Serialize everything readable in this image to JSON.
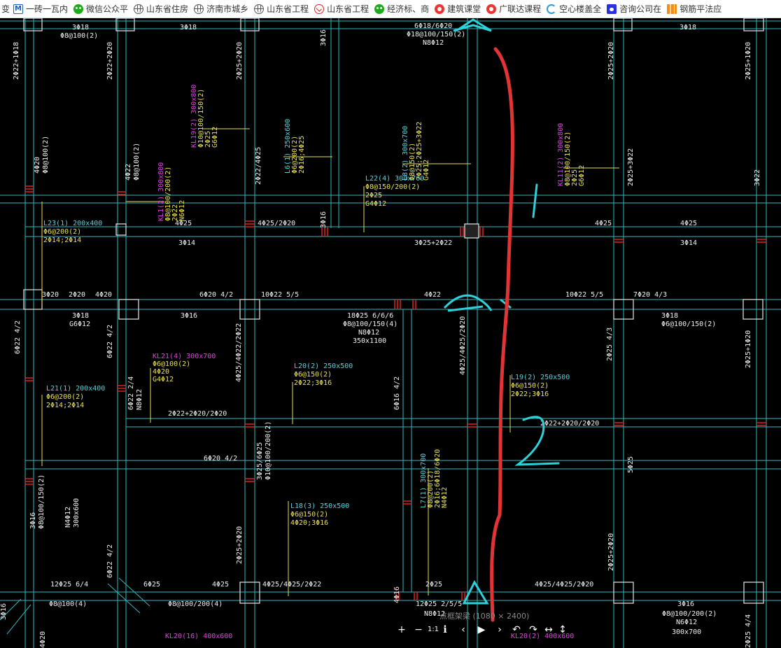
{
  "bookmarks": {
    "edge_glyph": "变",
    "items": [
      {
        "label": "一砖一瓦内",
        "icon": "m-logo-icon"
      },
      {
        "label": "微信公众平",
        "icon": "wechat-icon"
      },
      {
        "label": "山东省住房",
        "icon": "globe-icon"
      },
      {
        "label": "济南市城乡",
        "icon": "globe-icon"
      },
      {
        "label": "山东省工程",
        "icon": "globe-icon"
      },
      {
        "label": "山东省工程",
        "icon": "shield-icon"
      },
      {
        "label": "经济标、商",
        "icon": "wechat-icon"
      },
      {
        "label": "建筑课堂",
        "icon": "red-circle-icon"
      },
      {
        "label": "广联达课程",
        "icon": "red-circle-icon"
      },
      {
        "label": "空心楼盖全",
        "icon": "c-logo-icon"
      },
      {
        "label": "咨询公司在",
        "icon": "paw-icon"
      },
      {
        "label": "钢筋平法应",
        "icon": "bars-icon"
      }
    ]
  },
  "drawing": {
    "beam_labels": [
      {
        "lines": [
          "KL19(2) 300x800",
          "Φ10@100/150(2)",
          "2Φ25",
          "G6Φ12"
        ],
        "color": "magenta"
      },
      {
        "lines": [
          "KL1(2) 300x800",
          "Φ8@100/200(2)",
          "2Φ22",
          "N6Φ12"
        ],
        "color": "magenta"
      },
      {
        "lines": [
          "KL11(2) 300x800",
          "Φ8@100/150(2)",
          "2Φ25",
          "G6Φ12"
        ],
        "color": "magenta"
      },
      {
        "lines": [
          "KL21(4) 300x700",
          "Φ6@100(2)",
          "4Φ20",
          "G4Φ12"
        ],
        "color": "magenta"
      },
      {
        "lines": [
          "L6(1) 250x600",
          "Φ6@200(2)",
          "2Φ16;4Φ25"
        ],
        "color": "cyan"
      },
      {
        "lines": [
          "L8(2) 300x700",
          "Φ8@150(2)",
          "2Φ25;2Φ25+3Φ22",
          "G4Φ12"
        ],
        "color": "cyan"
      },
      {
        "lines": [
          "L22(4) 300x700",
          "Φ8@150/200(2)",
          "2Φ25",
          "G4Φ12"
        ],
        "color": "cyan"
      },
      {
        "lines": [
          "L23(1) 200x400",
          "Φ6@200(2)",
          "2Φ14;2Φ14"
        ],
        "color": "cyan"
      },
      {
        "lines": [
          "L21(1) 200x400",
          "Φ6@200(2)",
          "2Φ14;2Φ14"
        ],
        "color": "cyan"
      },
      {
        "lines": [
          "L20(2) 250x500",
          "Φ6@150(2)",
          "2Φ22;3Φ16"
        ],
        "color": "cyan"
      },
      {
        "lines": [
          "L19(2) 250x500",
          "Φ6@150(2)",
          "2Φ22;3Φ16"
        ],
        "color": "cyan"
      },
      {
        "lines": [
          "L18(3) 250x500",
          "Φ6@150(2)",
          "4Φ20;3Φ16"
        ],
        "color": "cyan"
      },
      {
        "lines": [
          "L7(1) 300x700",
          "Φ8@200(2)",
          "2Φ16;6Φ18/6Φ20",
          "N4Φ12"
        ],
        "color": "cyan"
      }
    ],
    "top_row_texts": [
      {
        "text": "3Φ18"
      },
      {
        "text": "Φ8@100(2)"
      },
      {
        "text": "3Φ18"
      },
      {
        "text": "6Φ18/6Φ20"
      },
      {
        "text": "Φ18@100/150(2)"
      },
      {
        "text": "N8Φ12"
      },
      {
        "text": "3Φ18"
      }
    ],
    "rebar_texts": [
      "4Φ25",
      "4Φ25/2Φ20",
      "3Φ14",
      "3Φ25+2Φ22",
      "4Φ25",
      "4Φ25",
      "3Φ14",
      "3Φ20",
      "2Φ20",
      "4Φ20",
      "6Φ20 4/2",
      "10Φ22 5/5",
      "4Φ22",
      "10Φ22 5/5",
      "7Φ20 4/3",
      "3Φ18",
      "G6Φ12",
      "3Φ16",
      "18Φ25 6/6/6",
      "Φ8@100/150(4)",
      "N8Φ12",
      "350x1100",
      "3Φ18",
      "Φ6@100/150(2)",
      "2Φ22+2Φ20/2Φ20",
      "2Φ22+2Φ20/2Φ20",
      "6Φ20 4/2",
      "12Φ25 6/4",
      "6Φ25",
      "4Φ25",
      "4Φ25/4Φ25/2Φ22",
      "2Φ25",
      "4Φ25/4Φ25/2Φ20",
      "Φ8@100(4)",
      "Φ8@100/200(4)",
      "12Φ25 2/5/5",
      "N8Φ12",
      "3Φ16",
      "Φ8@100/200(2)",
      "N6Φ12",
      "300x700",
      "KL20(16) 400x600",
      "KL20(2) 400x600"
    ],
    "vertical_texts": [
      "2Φ22+1Φ18",
      "2Φ22+2Φ20",
      "2Φ25+2Φ20",
      "3Φ16",
      "2Φ25+2Φ20",
      "2Φ25+1Φ20",
      "4Φ20",
      "Φ8@100(2)",
      "4Φ22",
      "Φ8@100(2)",
      "2Φ22/4Φ25",
      "3Φ16",
      "2Φ25+3Φ22",
      "3Φ22",
      "6Φ22 4/2",
      "6Φ22 4/2",
      "6Φ22 2/4",
      "N8Φ12",
      "4Φ25/4Φ22/2Φ22",
      "6Φ16 4/2",
      "4Φ25/4Φ25/2Φ20",
      "2Φ25 4/3",
      "2Φ25+1Φ20",
      "5Φ25",
      "3Φ16",
      "Φ8@100/150(2)",
      "N4Φ12",
      "300x600",
      "3Φ25/6Φ25",
      "Φ10@100/200(2)",
      "6Φ22 4/2",
      "2Φ25+2Φ20",
      "4Φ16",
      "2Φ25+2Φ20",
      "3Φ16",
      "2Φ25 4/4",
      "4Φ20"
    ],
    "annotations": {
      "support_marks": 3,
      "handwritten_1": "1",
      "handwritten_2": "2"
    }
  },
  "viewer": {
    "caption": "点框架梁 (1080 × 2400)",
    "buttons": [
      {
        "name": "zoom-in-button",
        "glyph": "+"
      },
      {
        "name": "zoom-out-button",
        "glyph": "−"
      },
      {
        "name": "page-indicator",
        "glyph": "1:1"
      },
      {
        "name": "info-button",
        "glyph": "ℹ"
      },
      {
        "name": "prev-button",
        "glyph": "‹"
      },
      {
        "name": "play-button",
        "glyph": "▶"
      },
      {
        "name": "next-button",
        "glyph": "›"
      },
      {
        "name": "rotate-left-button",
        "glyph": "↶"
      },
      {
        "name": "rotate-right-button",
        "glyph": "↷"
      },
      {
        "name": "flip-horizontal-button",
        "glyph": "↔"
      },
      {
        "name": "flip-vertical-button",
        "glyph": "↕"
      }
    ]
  }
}
